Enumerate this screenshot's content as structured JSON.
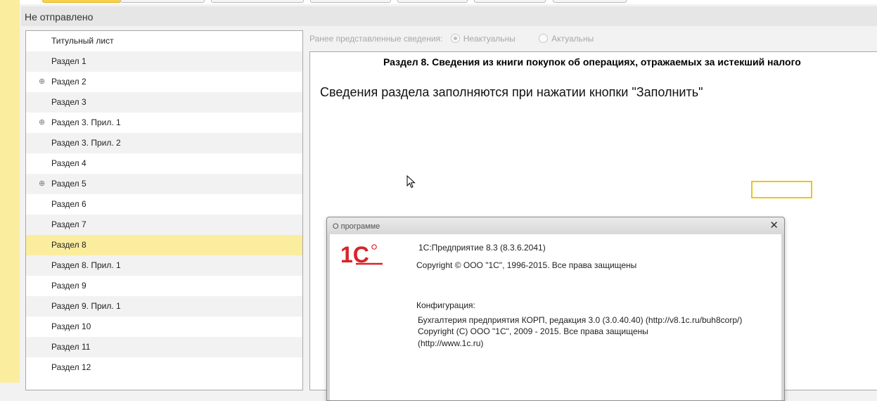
{
  "app": {
    "status": "Не отправлено"
  },
  "nav": {
    "items": [
      {
        "label": "Титульный лист",
        "expandable": false
      },
      {
        "label": "Раздел 1",
        "expandable": false
      },
      {
        "label": "Раздел 2",
        "expandable": true
      },
      {
        "label": "Раздел 3",
        "expandable": false
      },
      {
        "label": "Раздел 3. Прил. 1",
        "expandable": true
      },
      {
        "label": "Раздел 3. Прил. 2",
        "expandable": false
      },
      {
        "label": "Раздел 4",
        "expandable": false
      },
      {
        "label": "Раздел 5",
        "expandable": true
      },
      {
        "label": "Раздел 6",
        "expandable": false
      },
      {
        "label": "Раздел 7",
        "expandable": false
      },
      {
        "label": "Раздел 8",
        "expandable": false,
        "selected": true
      },
      {
        "label": "Раздел 8. Прил. 1",
        "expandable": false
      },
      {
        "label": "Раздел 9",
        "expandable": false
      },
      {
        "label": "Раздел 9. Прил. 1",
        "expandable": false
      },
      {
        "label": "Раздел 10",
        "expandable": false
      },
      {
        "label": "Раздел 11",
        "expandable": false
      },
      {
        "label": "Раздел 12",
        "expandable": false
      }
    ],
    "expand_icon_glyph": "⊕"
  },
  "previous_info": {
    "label": "Ранее представленные сведения:",
    "options": [
      {
        "label": "Неактуальны",
        "checked": true
      },
      {
        "label": "Актуальны",
        "checked": false
      }
    ]
  },
  "document": {
    "title": "Раздел 8. Сведения из книги покупок об операциях, отражаемых за истекший налого",
    "message": "Сведения раздела заполняются при нажатии кнопки \"Заполнить\""
  },
  "about_dialog": {
    "title": "О программе",
    "close_glyph": "✕",
    "logo_text": "1С",
    "product_line": "1С:Предприятие 8.3 (8.3.6.2041)",
    "copyright_line": "Copyright © ООО \"1С\", 1996-2015. Все права защищены",
    "config_label": "Конфигурация:",
    "config_name": "Бухгалтерия предприятия КОРП, редакция 3.0 (3.0.40.40) (http://v8.1c.ru/buh8corp/)",
    "config_copyright": "Copyright (C) ООО \"1С\", 2009 - 2015. Все права защищены",
    "config_url": "(http://www.1c.ru)"
  },
  "colors": {
    "selected_row": "#fbed9e",
    "accent_yellow": "#f0c419",
    "logo_red": "#d8232a"
  }
}
